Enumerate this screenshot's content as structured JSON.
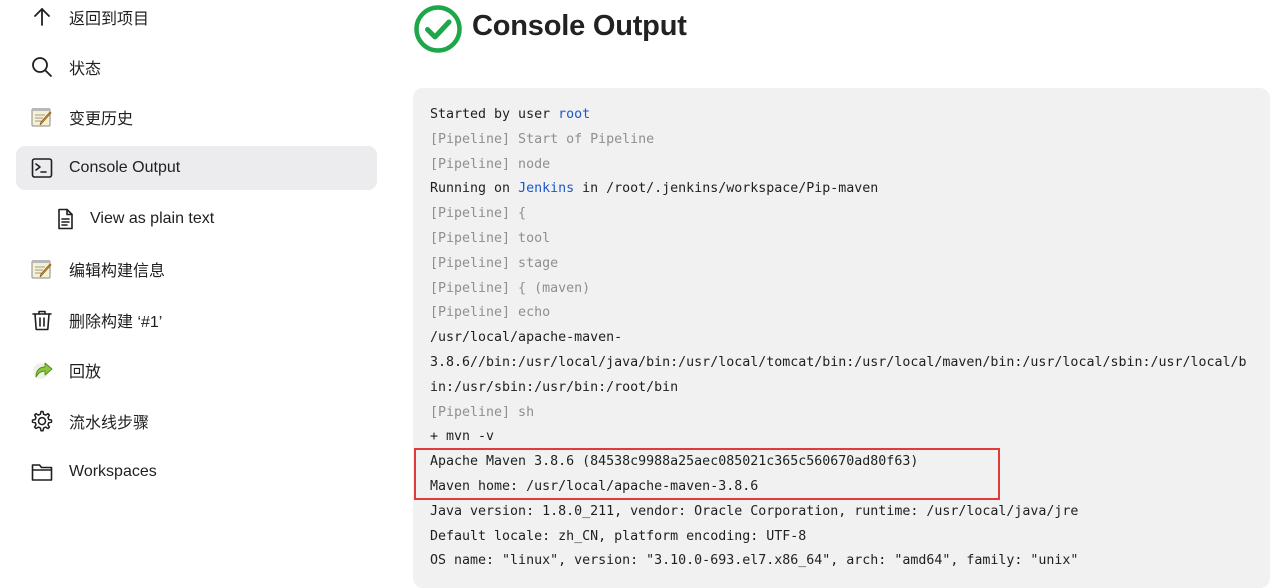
{
  "sidebar": {
    "items": [
      {
        "label": "返回到项目",
        "icon": "arrow-up-icon"
      },
      {
        "label": "状态",
        "icon": "search-icon"
      },
      {
        "label": "变更历史",
        "icon": "notepad-icon"
      },
      {
        "label": "Console Output",
        "icon": "terminal-icon",
        "active": true
      },
      {
        "label": "View as plain text",
        "icon": "document-icon"
      },
      {
        "label": "编辑构建信息",
        "icon": "notepad-icon"
      },
      {
        "label": "删除构建 ‘#1’",
        "icon": "trash-icon"
      },
      {
        "label": "回放",
        "icon": "replay-arrow-icon"
      },
      {
        "label": "流水线步骤",
        "icon": "gear-icon"
      },
      {
        "label": "Workspaces",
        "icon": "folder-icon"
      }
    ]
  },
  "main": {
    "title": "Console Output",
    "status_color": "#1ea64a",
    "console": {
      "line1_prefix": "Started by user ",
      "line1_link": "root",
      "line2": "[Pipeline] Start of Pipeline",
      "line3": "[Pipeline] node",
      "line4_prefix": "Running on ",
      "line4_link": "Jenkins",
      "line4_suffix": " in /root/.jenkins/workspace/Pip-maven",
      "line5": "[Pipeline] {",
      "line6": "[Pipeline] tool",
      "line7": "[Pipeline] stage",
      "line8": "[Pipeline] { (maven)",
      "line9": "[Pipeline] echo",
      "line10": "/usr/local/apache-maven-",
      "line11": "3.8.6//bin:/usr/local/java/bin:/usr/local/tomcat/bin:/usr/local/maven/bin:/usr/local/sbin:/usr/local/b",
      "line12": "in:/usr/sbin:/usr/bin:/root/bin",
      "line13": "[Pipeline] sh",
      "line14": "+ mvn -v",
      "line15": "Apache Maven 3.8.6 (84538c9988a25aec085021c365c560670ad80f63)",
      "line16": "Maven home: /usr/local/apache-maven-3.8.6",
      "line17": "Java version: 1.8.0_211, vendor: Oracle Corporation, runtime: /usr/local/java/jre",
      "line18": "Default locale: zh_CN, platform encoding: UTF-8",
      "line19": "OS name: \"linux\", version: \"3.10.0-693.el7.x86_64\", arch: \"amd64\", family: \"unix\""
    },
    "highlight_color": "#e03a3a"
  }
}
